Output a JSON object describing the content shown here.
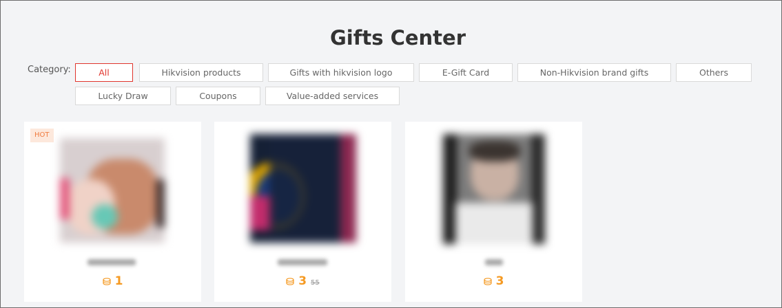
{
  "page": {
    "title": "Gifts Center"
  },
  "category": {
    "label": "Category:",
    "items": [
      "All",
      "Hikvision products",
      "Gifts with hikvision logo",
      "E-Gift Card",
      "Non-Hikvision brand gifts",
      "Others",
      "Lucky Draw",
      "Coupons",
      "Value-added services"
    ],
    "active": "All"
  },
  "colors": {
    "accent": "#e0342c",
    "points": "#f59a23",
    "hot_bg": "#fde8dc",
    "hot_text": "#f07b3f"
  },
  "products": [
    {
      "badge": "HOT",
      "points": "1",
      "original_points": "",
      "icon": "coin-icon"
    },
    {
      "badge": "",
      "points": "3",
      "original_points": "55",
      "icon": "coin-icon"
    },
    {
      "badge": "",
      "points": "3",
      "original_points": "",
      "icon": "coin-icon"
    }
  ]
}
